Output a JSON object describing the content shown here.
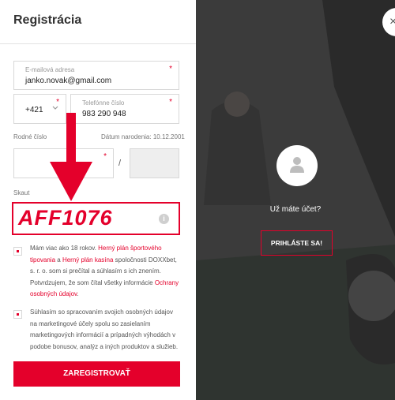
{
  "header": {
    "title": "Registrácia"
  },
  "form": {
    "email": {
      "label": "E-mailová adresa",
      "value": "janko.novak@gmail.com",
      "required": "*"
    },
    "prefix": {
      "value": "+421",
      "required": "*"
    },
    "phone": {
      "label": "Telefónne číslo",
      "value": "983 290 948",
      "required": "*"
    },
    "rodne_cislo": {
      "label": "Rodné číslo",
      "required": "*"
    },
    "dob": {
      "text": "Dátum narodenia: 10.12.2001"
    },
    "separator": "/",
    "skaut": {
      "label": "Skaut",
      "code": "AFF1076",
      "info_icon": "i"
    },
    "consent1": {
      "text_a": "Mám viac ako 18 rokov. ",
      "link_a": "Herný plán športového tipovania",
      "text_b": " a ",
      "link_b": "Herný plán kasína",
      "text_c": " spoločnosti DOXXbet, s. r. o. som si prečítal a súhlasím s ich znením. Potvrdzujem, že som čítal všetky informácie ",
      "link_c": "Ochrany osobných údajov",
      "text_d": "."
    },
    "consent2": {
      "text": "Súhlasím so spracovaním svojich osobných údajov na marketingové účely spolu so zasielaním marketingových informácií a prípadných výhodách v podobe bonusov, analýz a iných produktov a služieb."
    },
    "register_label": "ZAREGISTROVAŤ"
  },
  "side": {
    "question": "Už máte účet?",
    "login_label": "PRIHLÁSTE SA!",
    "close_glyph": "×"
  },
  "colors": {
    "accent": "#e4002b",
    "panel_dark": "#3a3a3a"
  },
  "icons": {
    "avatar": "user-icon",
    "close": "close-icon",
    "info": "info-icon",
    "arrow": "annotation-arrow-icon"
  }
}
